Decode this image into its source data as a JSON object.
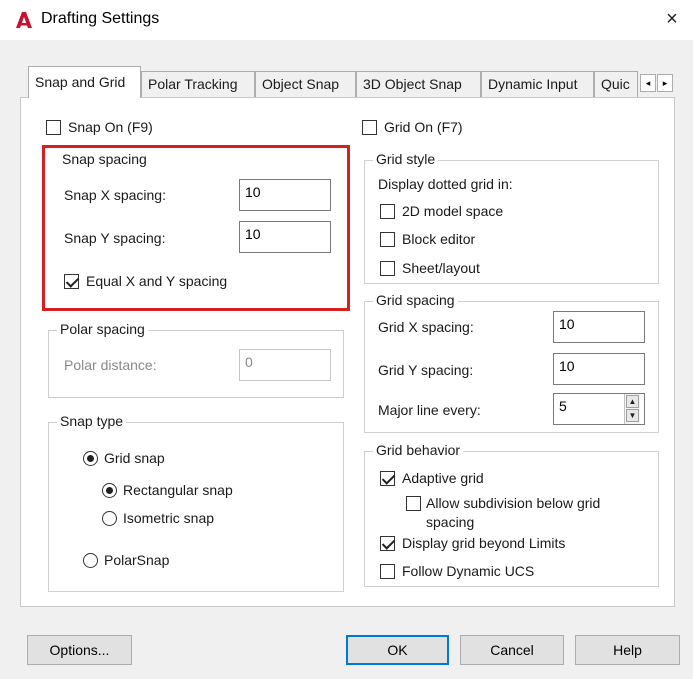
{
  "window": {
    "title": "Drafting Settings",
    "close_glyph": "×",
    "app_icon": "autocad-a-icon",
    "accent_color": "#c8102e"
  },
  "tabs": [
    {
      "label": "Snap and Grid",
      "active": true
    },
    {
      "label": "Polar Tracking",
      "active": false
    },
    {
      "label": "Object Snap",
      "active": false
    },
    {
      "label": "3D Object Snap",
      "active": false
    },
    {
      "label": "Dynamic Input",
      "active": false
    },
    {
      "label": "Quic",
      "active": false
    }
  ],
  "tab_scroll": {
    "left": "◂",
    "right": "▸"
  },
  "snap_on": {
    "label": "Snap On (F9)",
    "checked": false
  },
  "grid_on": {
    "label": "Grid On (F7)",
    "checked": false
  },
  "snap_spacing": {
    "legend": "Snap spacing",
    "x_label": "Snap X spacing:",
    "x_value": "10",
    "y_label": "Snap Y spacing:",
    "y_value": "10",
    "equal_label": "Equal X and Y spacing",
    "equal_checked": true,
    "highlight_color": "#d42020"
  },
  "polar_spacing": {
    "legend": "Polar spacing",
    "distance_label": "Polar distance:",
    "distance_value": "0",
    "disabled": true
  },
  "snap_type": {
    "legend": "Snap type",
    "grid_snap": {
      "label": "Grid snap",
      "selected": true
    },
    "rectangular_snap": {
      "label": "Rectangular snap",
      "selected": true
    },
    "isometric_snap": {
      "label": "Isometric snap",
      "selected": false
    },
    "polar_snap": {
      "label": "PolarSnap",
      "selected": false
    }
  },
  "grid_style": {
    "legend": "Grid style",
    "intro": "Display dotted grid in:",
    "model_space": {
      "label": "2D model space",
      "checked": false
    },
    "block_editor": {
      "label": "Block editor",
      "checked": false
    },
    "sheet_layout": {
      "label": "Sheet/layout",
      "checked": false
    }
  },
  "grid_spacing": {
    "legend": "Grid spacing",
    "x_label": "Grid X spacing:",
    "x_value": "10",
    "y_label": "Grid Y spacing:",
    "y_value": "10",
    "major_label": "Major line every:",
    "major_value": "5"
  },
  "grid_behavior": {
    "legend": "Grid behavior",
    "adaptive": {
      "label": "Adaptive grid",
      "checked": true
    },
    "subdivision_line1": "Allow subdivision below grid",
    "subdivision_line2": "spacing",
    "subdivision_checked": false,
    "beyond_limits": {
      "label": "Display grid beyond Limits",
      "checked": true
    },
    "follow_ucs": {
      "label": "Follow Dynamic UCS",
      "checked": false
    }
  },
  "buttons": {
    "options": "Options...",
    "ok": "OK",
    "cancel": "Cancel",
    "help": "Help",
    "default_border_color": "#0078d7"
  }
}
